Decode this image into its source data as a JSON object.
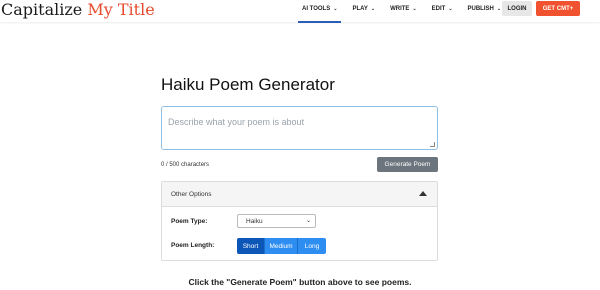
{
  "header": {
    "logo_part1": "Capitalize",
    "logo_part2": "My Title",
    "nav": [
      {
        "label": "AI TOOLS",
        "active": true
      },
      {
        "label": "PLAY",
        "active": false
      },
      {
        "label": "WRITE",
        "active": false
      },
      {
        "label": "EDIT",
        "active": false
      },
      {
        "label": "PUBLISH",
        "active": false
      }
    ],
    "login_label": "LOGIN",
    "cta_label": "GET CMT+",
    "chevron_icon": "chevron-down-icon"
  },
  "main": {
    "title": "Haiku Poem Generator",
    "textarea_placeholder": "Describe what your poem is about",
    "char_count": "0 / 500 characters",
    "generate_label": "Generate Poem",
    "options": {
      "header_label": "Other Options",
      "poem_type_label": "Poem Type:",
      "poem_type_value": "Haiku",
      "poem_length_label": "Poem Length:",
      "lengths": [
        "Short",
        "Medium",
        "Long"
      ],
      "selected_length": "Short"
    },
    "result_message": "Click the \"Generate Poem\" button above to see poems."
  },
  "colors": {
    "brand_accent": "#e64a2e",
    "cta": "#f0512e",
    "nav_active_underline": "#2b5fb7",
    "generate_button": "#6c757d",
    "segment_selected": "#0b56b7",
    "segment": "#2d8df0"
  }
}
